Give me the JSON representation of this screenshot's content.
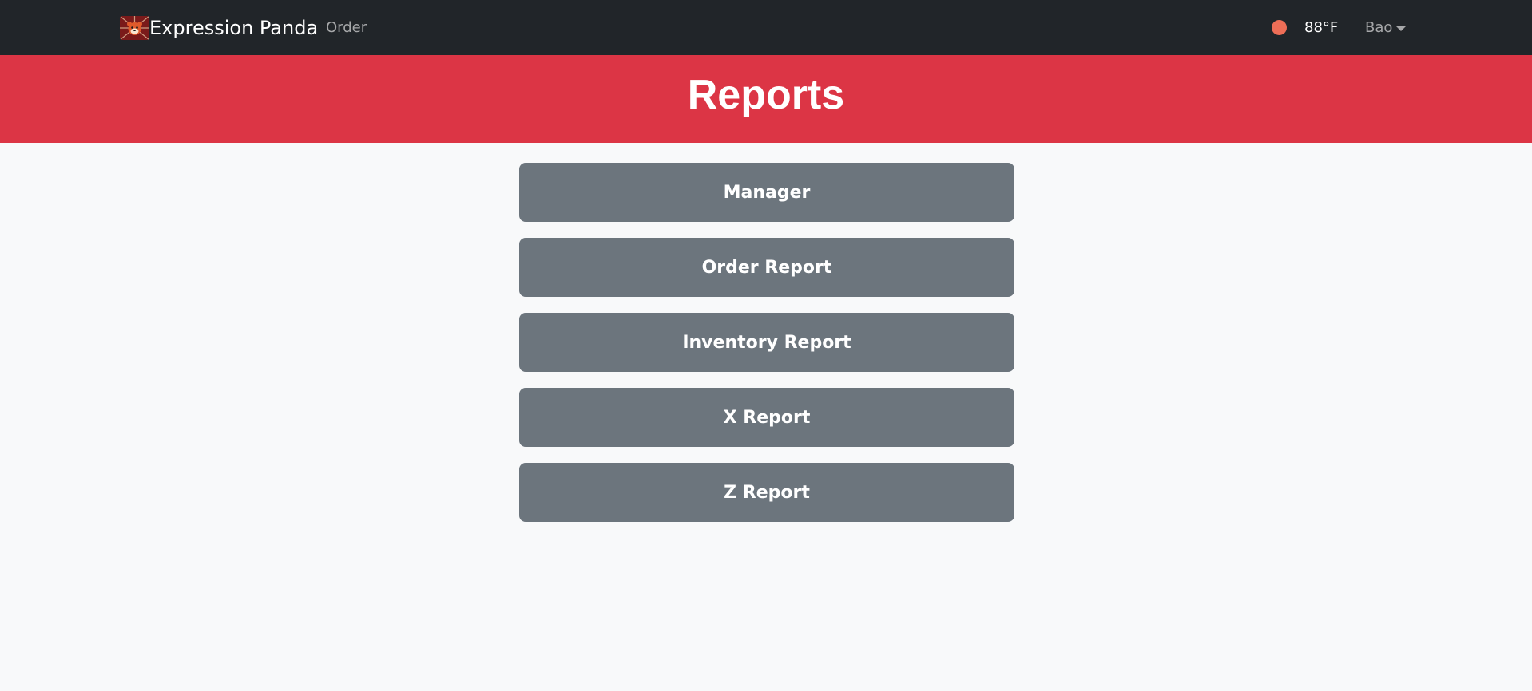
{
  "navbar": {
    "brand_text": "Expression Panda",
    "nav_order": "Order",
    "weather_temp": "88°F",
    "user_name": "Bao",
    "logo_icon": "panda-logo-icon",
    "weather_icon": "weather-status-dot-icon"
  },
  "banner": {
    "title": "Reports"
  },
  "buttons": [
    {
      "label": "Manager"
    },
    {
      "label": "Order Report"
    },
    {
      "label": "Inventory Report"
    },
    {
      "label": "X Report"
    },
    {
      "label": "Z Report"
    }
  ],
  "colors": {
    "navbar_bg": "#212529",
    "banner_bg": "#dc3545",
    "button_bg": "#6c757d",
    "page_bg": "#f8f9fa",
    "weather_dot": "#ee6e57"
  }
}
